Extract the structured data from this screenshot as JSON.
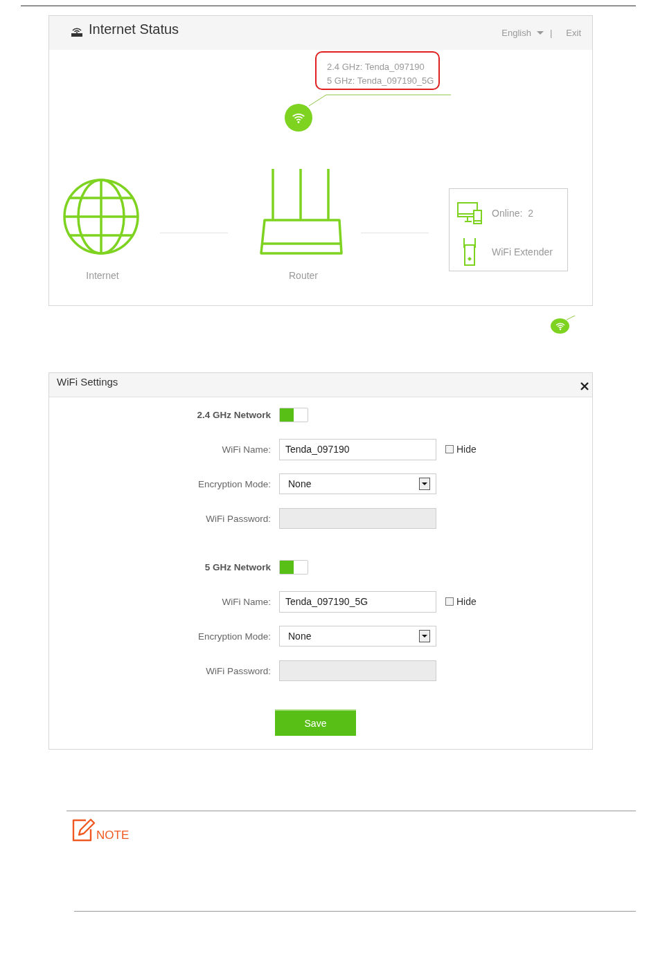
{
  "status_panel": {
    "title": "Internet Status",
    "language": "English",
    "separator": "|",
    "exit": "Exit",
    "wifi_names": [
      "2.4 GHz: Tenda_097190",
      "5 GHz: Tenda_097190_5G"
    ],
    "nodes": [
      {
        "kind": "internet",
        "label": "Internet"
      },
      {
        "kind": "router",
        "label": "Router"
      }
    ],
    "clients": [
      {
        "kind": "devices",
        "label": "Online:  2"
      },
      {
        "kind": "extender",
        "label": "WiFi Extender"
      }
    ]
  },
  "wifi_settings": {
    "title": "WiFi Settings",
    "networks": [
      {
        "label": "2.4 GHz Network",
        "on": true,
        "name_label": "WiFi Name:",
        "name": "Tenda_097190",
        "hide_label": "Hide",
        "hidden": false,
        "encryption_label": "Encryption Mode:",
        "encryption": "None",
        "password_label": "WiFi Password:",
        "password_disabled": true
      },
      {
        "label": "5 GHz Network",
        "on": true,
        "name_label": "WiFi Name:",
        "name": "Tenda_097190_5G",
        "hide_label": "Hide",
        "hidden": false,
        "encryption_label": "Encryption Mode:",
        "encryption": "None",
        "password_label": "WiFi Password:",
        "password_disabled": true
      }
    ],
    "save": "Save"
  },
  "note": {
    "label": "NOTE"
  }
}
